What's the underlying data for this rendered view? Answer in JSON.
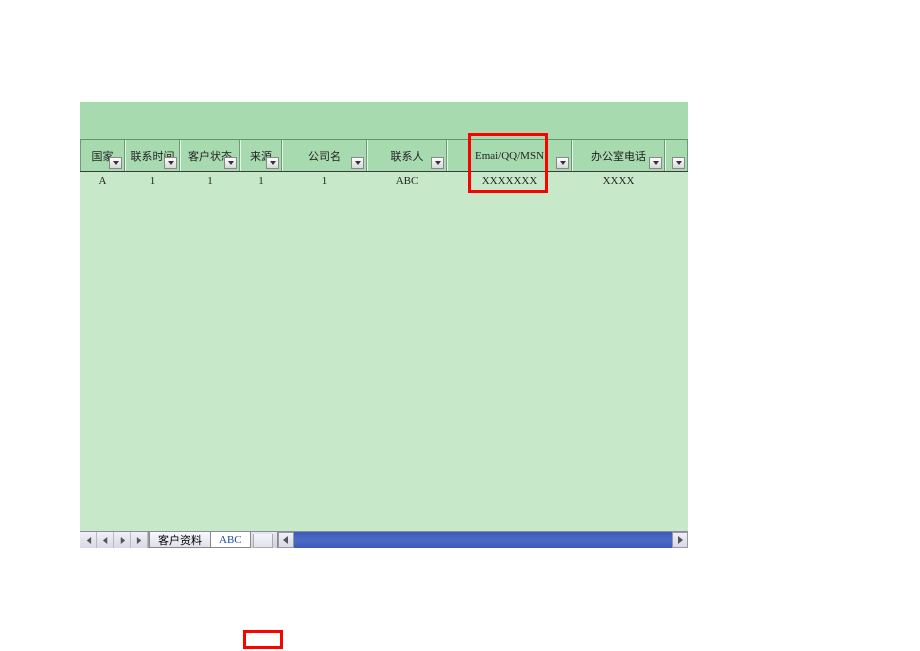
{
  "columns": [
    {
      "label": "国家",
      "width_class": "c0"
    },
    {
      "label": "联系时间",
      "width_class": "c1"
    },
    {
      "label": "客户状态",
      "width_class": "c2"
    },
    {
      "label": "来源",
      "width_class": "c3"
    },
    {
      "label": "公司名",
      "width_class": "c4"
    },
    {
      "label": "联系人",
      "width_class": "c5"
    },
    {
      "label": "Emai/QQ/MSN",
      "width_class": "c6"
    },
    {
      "label": "办公室电话",
      "width_class": "c7"
    },
    {
      "label": "",
      "width_class": "c8"
    }
  ],
  "rows": [
    {
      "cells": [
        "A",
        "1",
        "1",
        "1",
        "1",
        "ABC",
        "XXXXXXX",
        "XXXX",
        ""
      ]
    }
  ],
  "tabs": {
    "items": [
      {
        "label": "客户资料",
        "active": false
      },
      {
        "label": "ABC",
        "active": true
      }
    ]
  }
}
